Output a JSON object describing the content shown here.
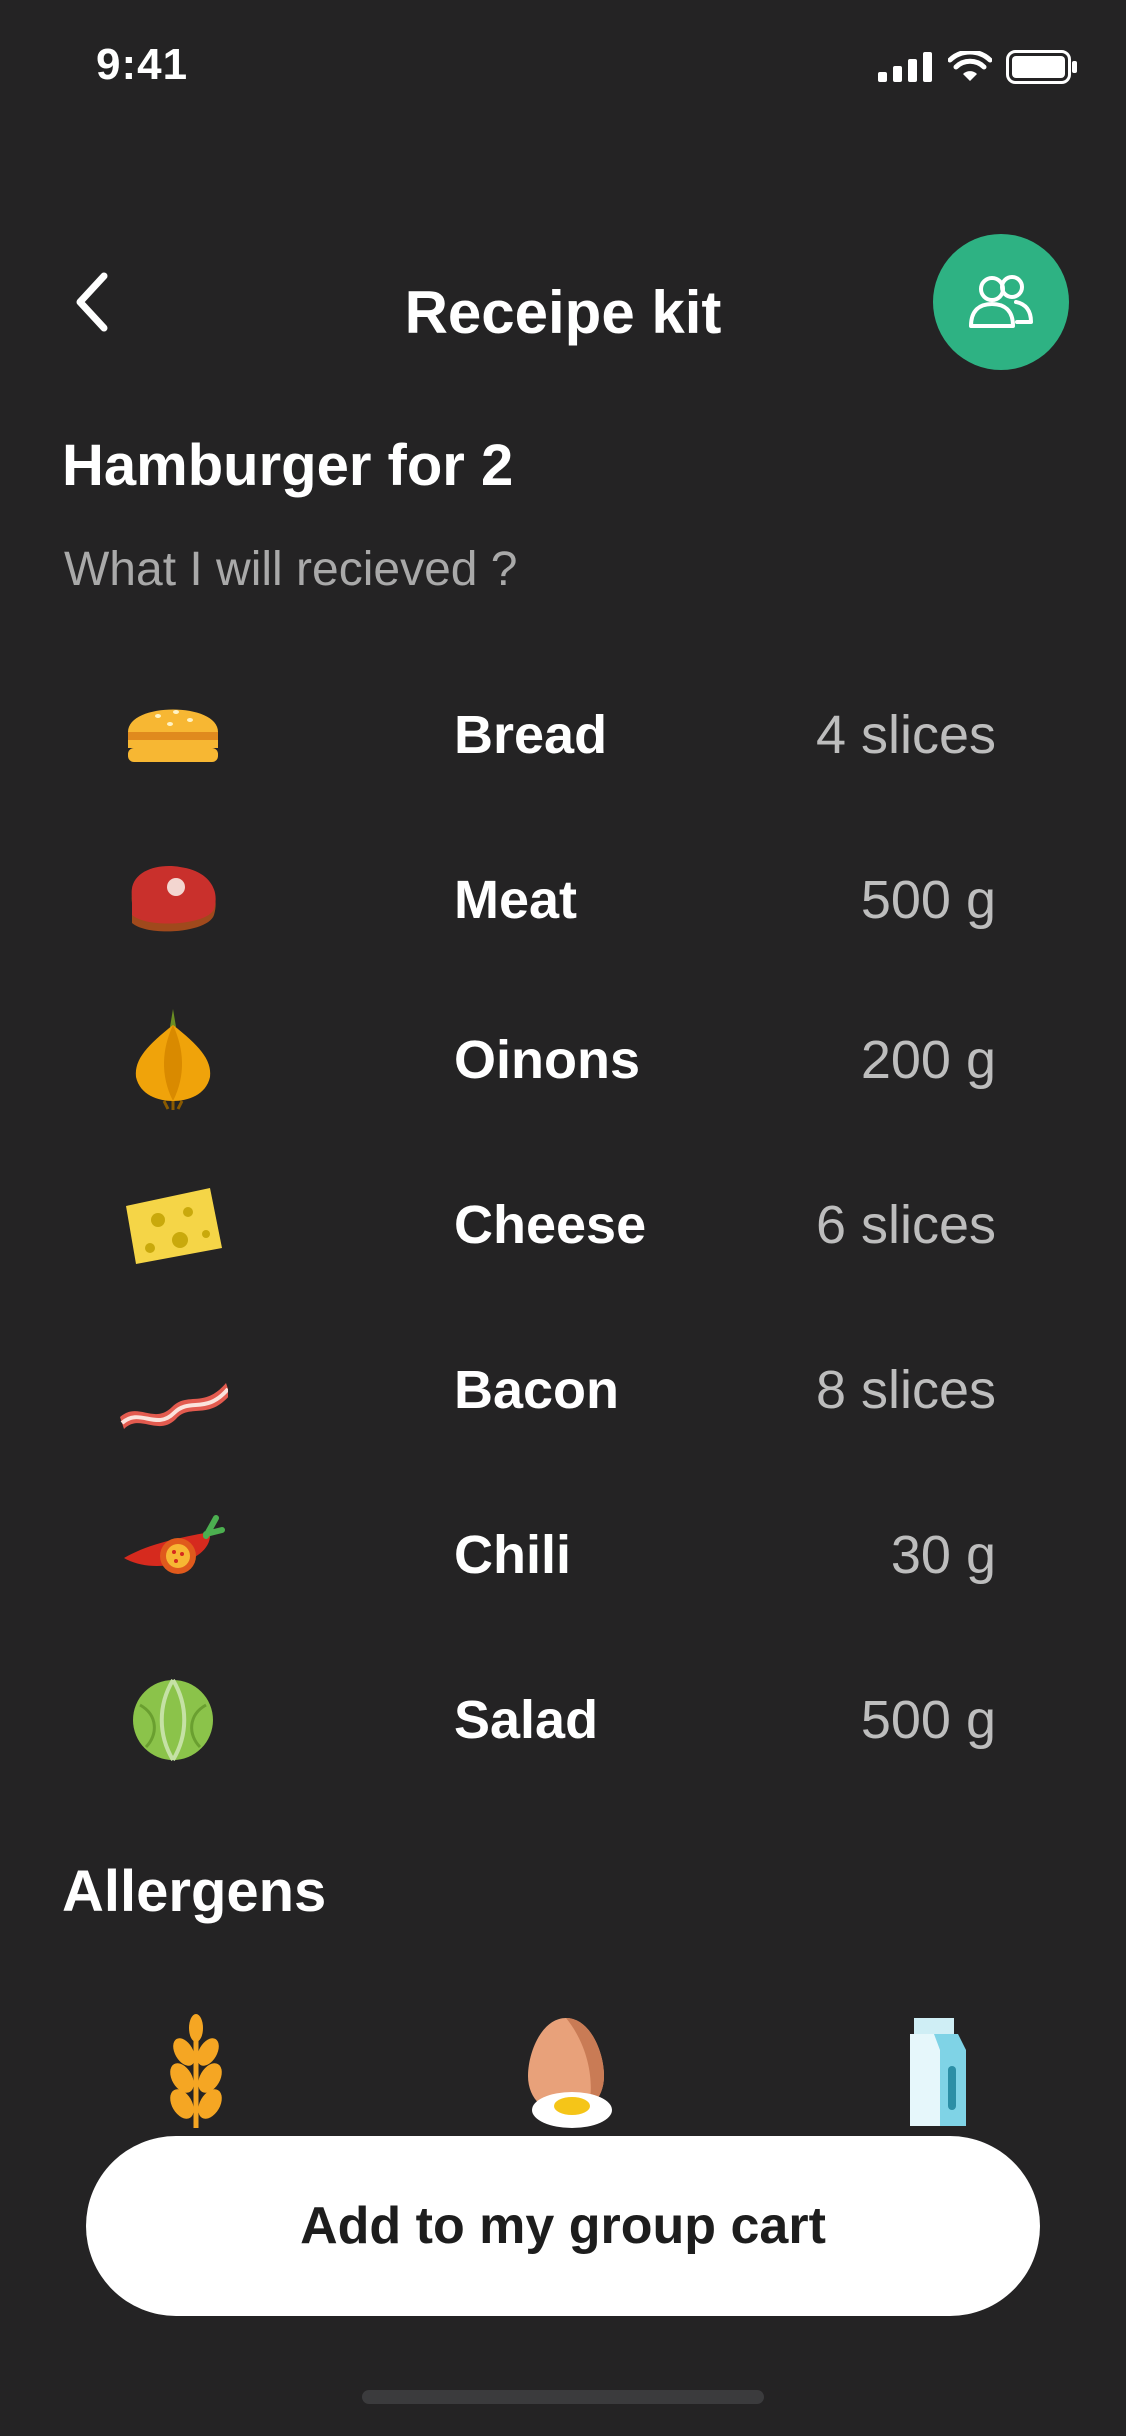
{
  "status_bar": {
    "time": "9:41",
    "signal_icon": "signal-icon",
    "wifi_icon": "wifi-icon",
    "battery_icon": "battery-icon"
  },
  "header": {
    "back_icon": "chevron-left-icon",
    "title": "Receipe kit",
    "group_icon": "group-icon",
    "accent": "#2eb283"
  },
  "recipe": {
    "title": "Hamburger for 2",
    "subtitle": "What I will recieved ?"
  },
  "ingredients": [
    {
      "icon": "bread-icon",
      "name": "Bread",
      "qty": "4 slices"
    },
    {
      "icon": "meat-icon",
      "name": "Meat",
      "qty": "500 g"
    },
    {
      "icon": "onion-icon",
      "name": "Oinons",
      "qty": "200 g"
    },
    {
      "icon": "cheese-icon",
      "name": "Cheese",
      "qty": "6 slices"
    },
    {
      "icon": "bacon-icon",
      "name": "Bacon",
      "qty": "8 slices"
    },
    {
      "icon": "chili-icon",
      "name": "Chili",
      "qty": "30 g"
    },
    {
      "icon": "salad-icon",
      "name": "Salad",
      "qty": "500 g"
    }
  ],
  "allergens": {
    "title": "Allergens",
    "items": [
      "wheat-icon",
      "egg-icon",
      "milk-icon"
    ]
  },
  "cta": {
    "label": "Add to my group cart"
  },
  "colors": {
    "background": "#242324",
    "text_secondary": "#a9a9a9",
    "button_bg": "#ffffff"
  }
}
